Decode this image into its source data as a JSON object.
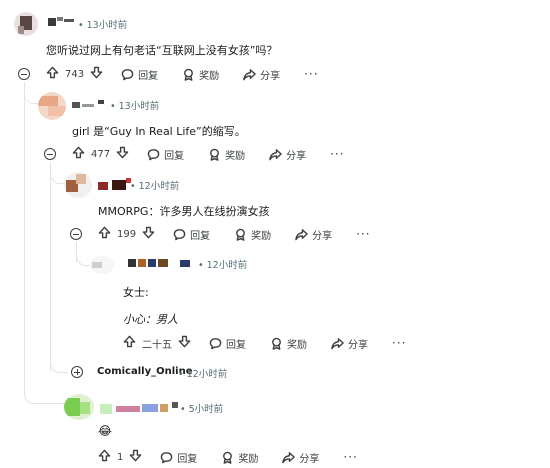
{
  "comments": [
    {
      "time": "13小时前",
      "text": "您听说过网上有句老话“互联网上没有女孩”吗？",
      "votes": "743",
      "reply": "回复",
      "award": "奖励",
      "share": "分享",
      "more": "···"
    },
    {
      "time": "13小时前",
      "text": "girl 是“Guy In Real Life”的缩写。",
      "votes": "477",
      "reply": "回复",
      "award": "奖励",
      "share": "分享",
      "more": "···"
    },
    {
      "time": "12小时前",
      "text": "MMORPG：许多男人在线扮演女孩",
      "votes": "199",
      "reply": "回复",
      "award": "奖励",
      "share": "分享",
      "more": "···"
    },
    {
      "time": "12小时前",
      "line1": "女士:",
      "line2": "小心：男人",
      "votes": "二十五",
      "reply": "回复",
      "award": "奖励",
      "share": "分享",
      "more": "···"
    },
    {
      "author": "Comically_Online",
      "time": "12小时前"
    },
    {
      "time": "5小时前",
      "emoji": "😂",
      "votes": "1",
      "reply": "回复",
      "award": "奖励",
      "share": "分享",
      "more": "···"
    }
  ],
  "separator": "•"
}
